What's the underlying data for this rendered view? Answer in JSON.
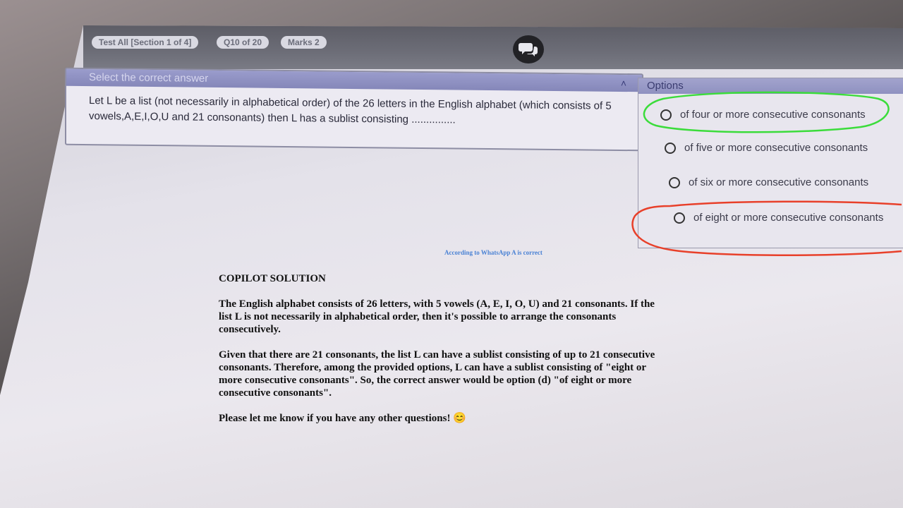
{
  "topbar": {
    "section_pill": "Test All [Section 1 of 4]",
    "question_pill": "Q10 of 20",
    "marks_pill": "Marks 2"
  },
  "question": {
    "header": "Select the correct answer",
    "text": "Let L be a list (not necessarily in alphabetical order) of the 26 letters in the English alphabet (which consists of 5 vowels,A,E,I,O,U and 21 consonants) then L has a sublist consisting ..............."
  },
  "options": {
    "header": "Options",
    "items": [
      {
        "label": "of four or more consecutive consonants"
      },
      {
        "label": "of five or more consecutive consonants"
      },
      {
        "label": "of six or more consecutive consonants"
      },
      {
        "label": "of eight or more consecutive consonants"
      }
    ],
    "annotation_colors": {
      "green_circle": "#3bdc3b",
      "red_circle": "#e8402a"
    }
  },
  "overlay": {
    "whatsapp_note": "According to WhatsApp A is correct",
    "solution_title": "COPILOT SOLUTION",
    "paragraph1": "The English alphabet consists of 26 letters, with 5 vowels (A, E, I, O, U) and 21 consonants. If the list L is not necessarily in alphabetical order, then it's possible to arrange the consonants consecutively.",
    "paragraph2": "Given that there are 21 consonants, the list L can have a sublist consisting of up to 21 consecutive consonants. Therefore, among the provided options, L can have a sublist consisting of \"eight or more consecutive consonants\". So, the correct answer would be option (d) \"of eight or more consecutive consonants\".",
    "paragraph3": "Please let me know if you have any other questions! 😊"
  },
  "icons": {
    "chat": "chat-bubbles-icon",
    "collapse": "chevron-up-icon",
    "radio": "radio-circle-icon"
  }
}
